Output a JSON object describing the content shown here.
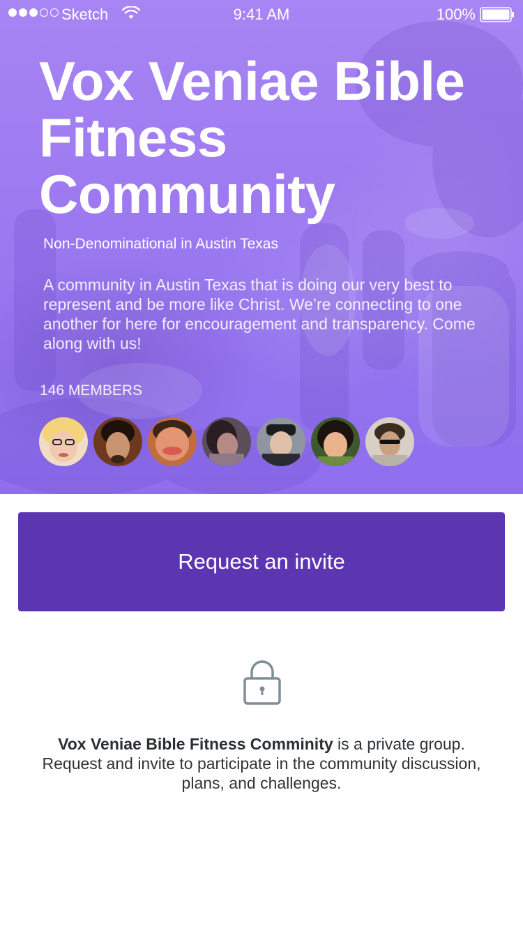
{
  "status_bar": {
    "carrier": "Sketch",
    "time": "9:41 AM",
    "battery": "100%",
    "signal_bars_filled": 3,
    "signal_bars_total": 5
  },
  "group": {
    "title": "Vox Veniae Bible Fitness Community",
    "denomination": "Non-Denominational in Austin Texas",
    "description": "A community in Austin Texas that is doing our very best to represent and be more like Christ. We’re connecting to one another for here for encouragement and transparency. Come along with us!",
    "members_label": "146 MEMBERS",
    "member_avatars": [
      "avatar-1",
      "avatar-2",
      "avatar-3",
      "avatar-4",
      "avatar-5",
      "avatar-6",
      "avatar-7"
    ]
  },
  "actions": {
    "request_invite_label": "Request an invite"
  },
  "private_notice": {
    "group_name": "Vox Veniae Bible Fitness Comminity",
    "text": " is a private group. Request and invite to participate in the community discussion, plans, and challenges."
  },
  "icons": {
    "wifi": "wifi-icon",
    "battery": "battery-icon",
    "lock": "lock-icon"
  },
  "colors": {
    "hero_tint": "#9b79f1",
    "button": "#5c35b1",
    "lock": "#7d8f95",
    "body_text": "#2f3337"
  }
}
